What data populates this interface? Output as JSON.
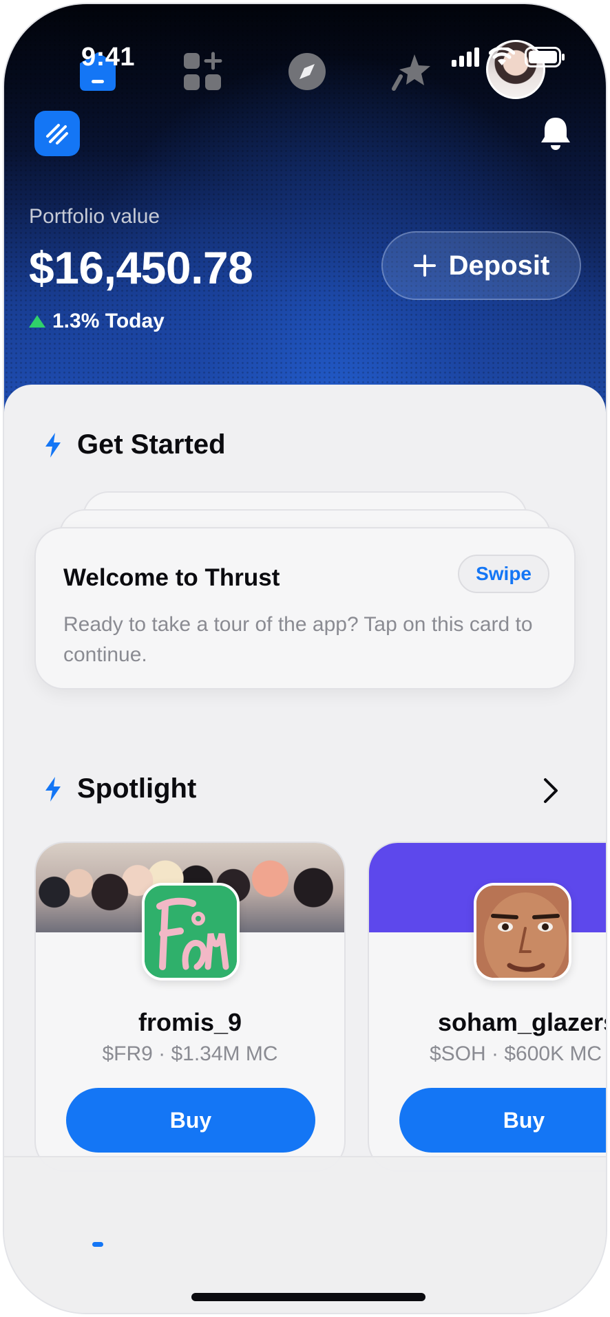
{
  "status_bar": {
    "time": "9:41"
  },
  "header": {
    "portfolio_label": "Portfolio value",
    "portfolio_value": "$16,450.78",
    "change": "1.3% Today",
    "deposit_label": "Deposit"
  },
  "get_started": {
    "title": "Get Started",
    "card_title": "Welcome to Thrust",
    "swipe_label": "Swipe",
    "card_body": "Ready to take a tour of the app? Tap on this card to continue."
  },
  "spotlight": {
    "title": "Spotlight",
    "items": [
      {
        "name": "fromis_9",
        "meta": "$FR9 · $1.34M MC",
        "buy_label": "Buy",
        "avatar_text": "From"
      },
      {
        "name": "soham_glazers",
        "meta": "$SOH · $600K MC",
        "buy_label": "Buy"
      }
    ]
  },
  "tabbar": {
    "tabs": [
      "home",
      "apps",
      "explore",
      "favorites",
      "profile"
    ],
    "active": "home"
  },
  "colors": {
    "accent": "#1476f5",
    "positive": "#2fd06a",
    "spotlight_banner": "#5d48ec"
  },
  "icons": [
    "app-logo-icon",
    "bell-icon",
    "plus-icon",
    "bolt-icon",
    "chevron-right-icon",
    "home-icon",
    "grid-plus-icon",
    "compass-icon",
    "star-icon"
  ]
}
